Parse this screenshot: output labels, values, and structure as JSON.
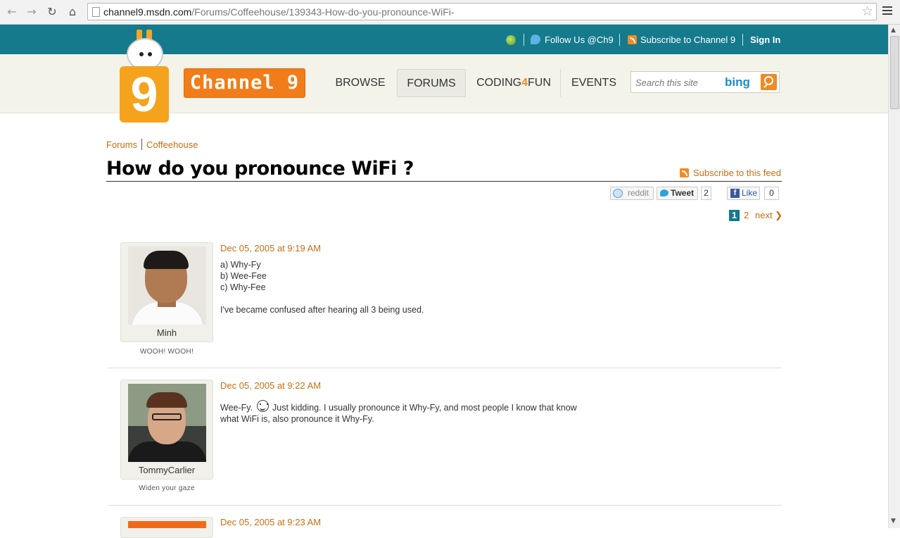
{
  "browser": {
    "url_domain": "channel9.msdn.com",
    "url_path": "/Forums/Coffeehouse/139343-How-do-you-pronounce-WiFi-"
  },
  "topbar": {
    "follow_label": "Follow Us @Ch9",
    "subscribe_label": "Subscribe to Channel 9",
    "signin_label": "Sign In"
  },
  "header": {
    "logo_digit": "9",
    "brand_text": "Channel 9",
    "nav": {
      "browse": "BROWSE",
      "forums": "FORUMS",
      "coding_pre": "CODING",
      "coding_four": "4",
      "coding_post": "FUN",
      "events": "EVENTS"
    },
    "search_placeholder": "Search this site",
    "search_brand": "bing"
  },
  "breadcrumb": {
    "forums": "Forums",
    "coffeehouse": "Coffeehouse"
  },
  "thread": {
    "title": "How do you pronounce WiFi ?",
    "subscribe_feed": "Subscribe to this feed"
  },
  "share": {
    "reddit_label": "reddit",
    "tweet_label": "Tweet",
    "tweet_count": "2",
    "like_label": "Like",
    "like_count": "0"
  },
  "pagination": {
    "current": "1",
    "page2": "2",
    "next": "next ❯"
  },
  "posts": [
    {
      "author": "Minh",
      "tagline": "WOOH!  WOOH!",
      "date": "Dec 05, 2005 at 9:19 AM",
      "body": "a) Why-Fy\nb) Wee-Fee\nc) Why-Fee\n\nI've became confused after hearing all 3 being used."
    },
    {
      "author": "TommyCarlier",
      "tagline": "Widen your gaze",
      "date": "Dec 05, 2005 at 9:22 AM",
      "body_pre": "Wee-Fy.",
      "body_post": "Just kidding. I usually pronounce it Why-Fy, and most people I know that know",
      "body_line2": "what WiFi is, also pronounce it Why-Fy."
    },
    {
      "date": "Dec 05, 2005 at 9:23 AM"
    }
  ],
  "colors": {
    "topbar": "#157a8c",
    "accent_orange": "#f07d1a",
    "link_orange": "#c66e10"
  }
}
